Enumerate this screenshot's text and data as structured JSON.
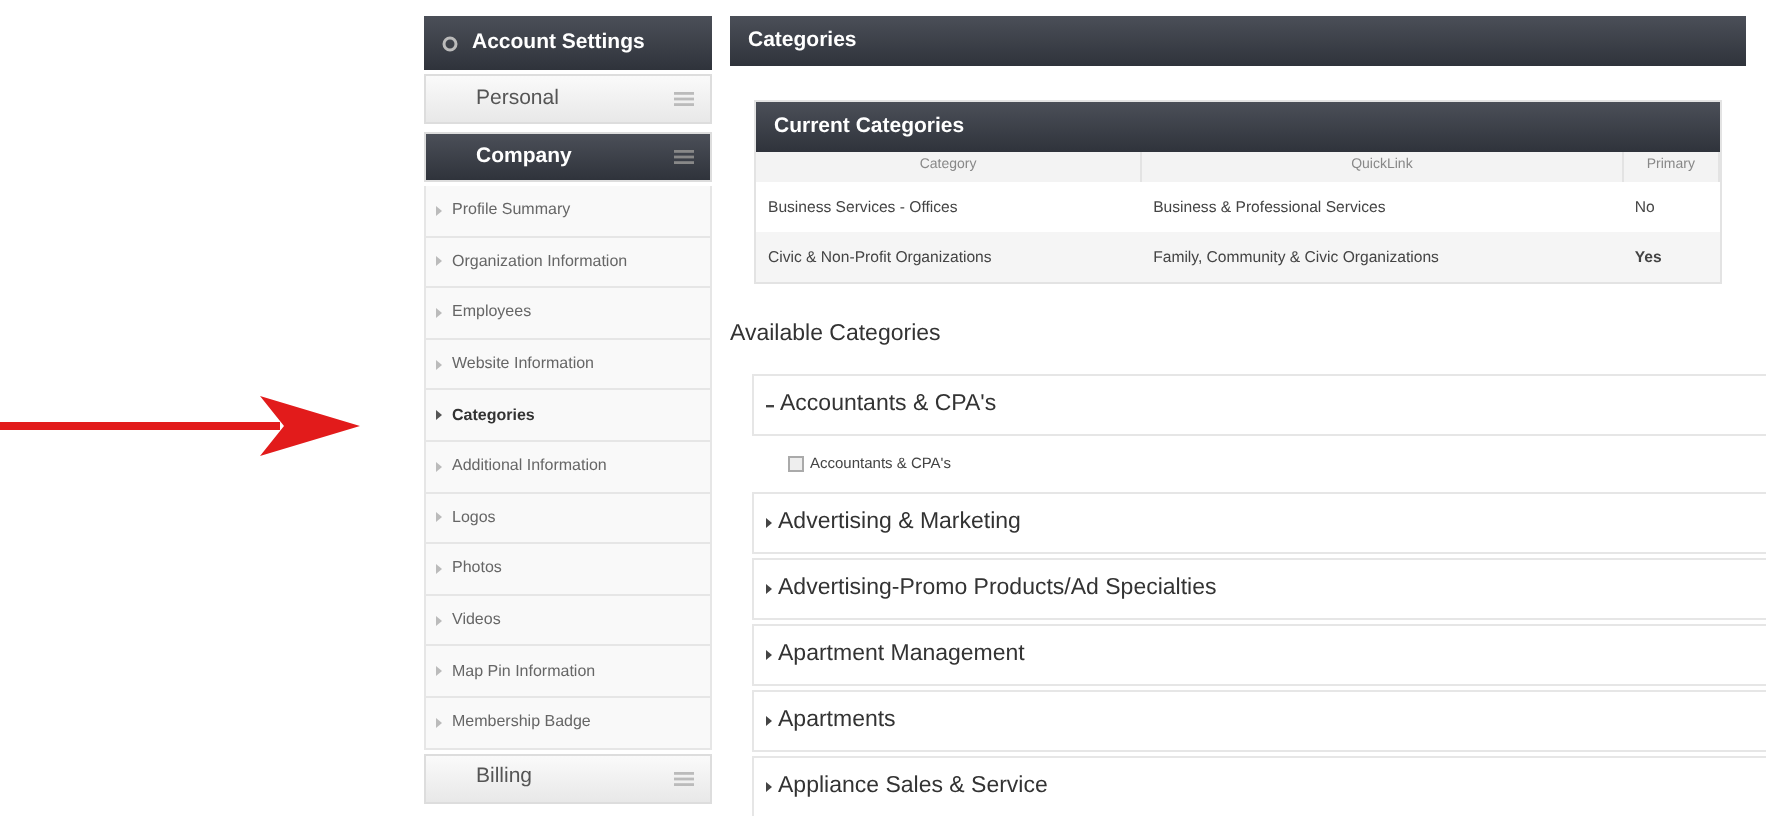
{
  "sidebar": {
    "title": "Account Settings",
    "groups": [
      {
        "label": "Personal",
        "expanded": false
      },
      {
        "label": "Company",
        "expanded": true,
        "items": [
          {
            "label": "Profile Summary",
            "selected": false
          },
          {
            "label": "Organization Information",
            "selected": false
          },
          {
            "label": "Employees",
            "selected": false
          },
          {
            "label": "Website Information",
            "selected": false
          },
          {
            "label": "Categories",
            "selected": true
          },
          {
            "label": "Additional Information",
            "selected": false
          },
          {
            "label": "Logos",
            "selected": false
          },
          {
            "label": "Photos",
            "selected": false
          },
          {
            "label": "Videos",
            "selected": false
          },
          {
            "label": "Map Pin Information",
            "selected": false
          },
          {
            "label": "Membership Badge",
            "selected": false
          }
        ]
      },
      {
        "label": "Billing",
        "expanded": false
      }
    ]
  },
  "main": {
    "title": "Categories",
    "current": {
      "title": "Current Categories",
      "columns": [
        "Category",
        "QuickLink",
        "Primary"
      ],
      "rows": [
        {
          "category": "Business Services - Offices",
          "quicklink": "Business & Professional Services",
          "primary": "No",
          "emphasis": false
        },
        {
          "category": "Civic & Non-Profit Organizations",
          "quicklink": "Family, Community & Civic Organizations",
          "primary": "Yes",
          "emphasis": true
        }
      ]
    },
    "available_title": "Available Categories",
    "available": [
      {
        "label": "Accountants & CPA's",
        "expanded": true,
        "options": [
          {
            "label": "Accountants & CPA's",
            "checked": false
          }
        ]
      },
      {
        "label": "Advertising & Marketing",
        "expanded": false
      },
      {
        "label": "Advertising-Promo Products/Ad Specialties",
        "expanded": false
      },
      {
        "label": "Apartment Management",
        "expanded": false
      },
      {
        "label": "Apartments",
        "expanded": false
      },
      {
        "label": "Appliance Sales & Service",
        "expanded": false
      }
    ]
  }
}
